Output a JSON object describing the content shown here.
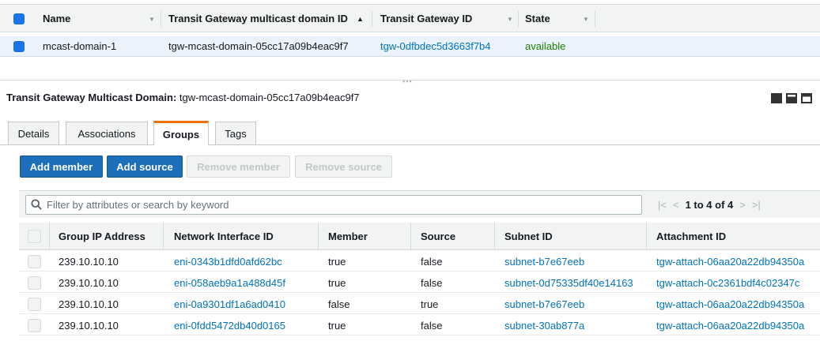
{
  "top_table": {
    "columns": [
      "Name",
      "Transit Gateway multicast domain ID",
      "Transit Gateway ID",
      "State"
    ],
    "row": {
      "name": "mcast-domain-1",
      "domain_id": "tgw-mcast-domain-05cc17a09b4eac9f7",
      "tgw_id": "tgw-0dfbdec5d3663f7b4",
      "state": "available"
    }
  },
  "details": {
    "title_label": "Transit Gateway Multicast Domain:",
    "title_value": "tgw-mcast-domain-05cc17a09b4eac9f7",
    "tabs": [
      "Details",
      "Associations",
      "Groups",
      "Tags"
    ],
    "active_tab": "Groups",
    "buttons": {
      "add_member": "Add member",
      "add_source": "Add source",
      "remove_member": "Remove member",
      "remove_source": "Remove source"
    },
    "filter_placeholder": "Filter by attributes or search by keyword",
    "pager": "1 to 4 of 4"
  },
  "groups_table": {
    "columns": [
      "Group IP Address",
      "Network Interface ID",
      "Member",
      "Source",
      "Subnet ID",
      "Attachment ID"
    ],
    "rows": [
      {
        "ip": "239.10.10.10",
        "eni": "eni-0343b1dfd0afd62bc",
        "member": "true",
        "source": "false",
        "subnet": "subnet-b7e67eeb",
        "attach": "tgw-attach-06aa20a22db94350a"
      },
      {
        "ip": "239.10.10.10",
        "eni": "eni-058aeb9a1a488d45f",
        "member": "true",
        "source": "false",
        "subnet": "subnet-0d75335df40e14163",
        "attach": "tgw-attach-0c2361bdf4c02347c"
      },
      {
        "ip": "239.10.10.10",
        "eni": "eni-0a9301df1a6ad0410",
        "member": "false",
        "source": "true",
        "subnet": "subnet-b7e67eeb",
        "attach": "tgw-attach-06aa20a22db94350a"
      },
      {
        "ip": "239.10.10.10",
        "eni": "eni-0fdd5472db40d0165",
        "member": "true",
        "source": "false",
        "subnet": "subnet-30ab877a",
        "attach": "tgw-attach-06aa20a22db94350a"
      }
    ]
  },
  "colors": {
    "primary": "#1d6fbb",
    "link": "#0073bb",
    "status_ok": "#1d8102",
    "tab_accent": "#ec7211"
  }
}
